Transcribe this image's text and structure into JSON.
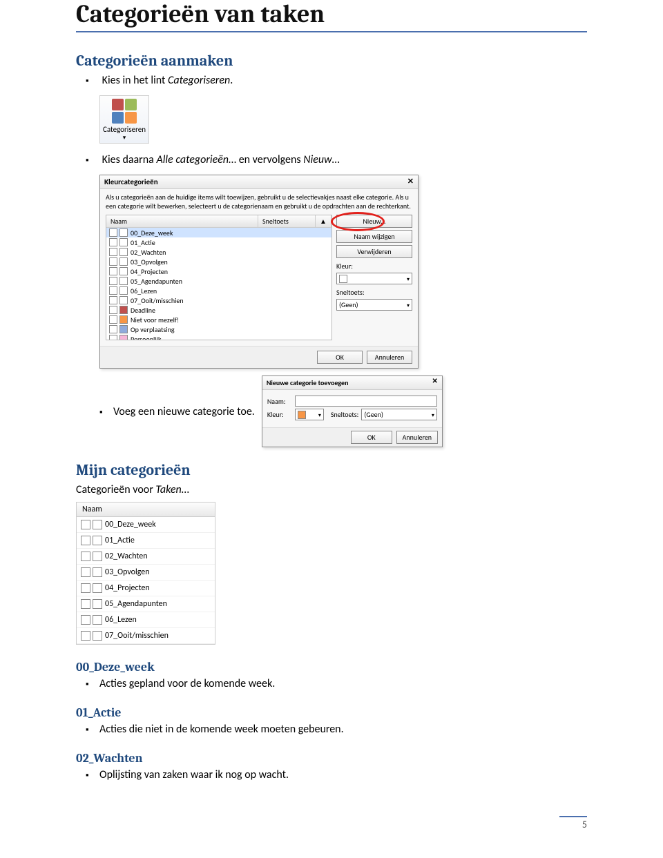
{
  "page": {
    "title": "Categorieën van taken",
    "page_number": "5"
  },
  "sections": {
    "aanmaken": {
      "title": "Categorieën aanmaken",
      "step1_pre": "Kies in het lint ",
      "step1_em": "Categoriseren",
      "step1_post": ".",
      "step2_pre": "Kies daarna ",
      "step2_em": "Alle categorieën",
      "step2_mid": "… en vervolgens ",
      "step2_em2": "Nieuw",
      "step2_post": "…",
      "step3": "Voeg een nieuwe categorie toe."
    },
    "mijn": {
      "title": "Mijn categorieën",
      "intro_pre": "Categorieën voor ",
      "intro_em": "Taken",
      "intro_post": "…"
    },
    "sub_00": {
      "title": "00_Deze_week",
      "bullet": "Acties gepland voor de komende week."
    },
    "sub_01": {
      "title": "01_Actie",
      "bullet": "Acties die niet in de komende week moeten gebeuren."
    },
    "sub_02": {
      "title": "02_Wachten",
      "bullet": "Oplijsting van zaken waar ik nog op wacht."
    }
  },
  "ribbon": {
    "label": "Categoriseren"
  },
  "dlg_main": {
    "title": "Kleurcategorieën",
    "description": "Als u categorieën aan de huidige items wilt toewijzen, gebruikt u de selectievakjes naast elke categorie. Als u een categorie wilt bewerken, selecteert u de categorienaam en gebruikt u de opdrachten aan de rechterkant.",
    "col_name": "Naam",
    "col_sneltoets": "Sneltoets",
    "btn_nieuw": "Nieuw...",
    "btn_rename": "Naam wijzigen",
    "btn_delete": "Verwijderen",
    "lbl_kleur": "Kleur:",
    "lbl_sneltoets": "Sneltoets:",
    "sneltoets_value": "(Geen)",
    "btn_ok": "OK",
    "btn_cancel": "Annuleren",
    "items": [
      {
        "label": "00_Deze_week",
        "swatch": "none",
        "selected": true
      },
      {
        "label": "01_Actie",
        "swatch": "none"
      },
      {
        "label": "02_Wachten",
        "swatch": "none"
      },
      {
        "label": "03_Opvolgen",
        "swatch": "none"
      },
      {
        "label": "04_Projecten",
        "swatch": "none"
      },
      {
        "label": "05_Agendapunten",
        "swatch": "none"
      },
      {
        "label": "06_Lezen",
        "swatch": "none"
      },
      {
        "label": "07_Ooit/misschien",
        "swatch": "none"
      },
      {
        "label": "Deadline",
        "swatch": "red"
      },
      {
        "label": "Niet voor mezelf!",
        "swatch": "orange"
      },
      {
        "label": "Op verplaatsing",
        "swatch": "blue"
      },
      {
        "label": "Persoonlijk",
        "swatch": "pink"
      }
    ]
  },
  "dlg_new": {
    "title": "Nieuwe categorie toevoegen",
    "lbl_naam": "Naam:",
    "lbl_kleur": "Kleur:",
    "lbl_sneltoets": "Sneltoets:",
    "sneltoets_value": "(Geen)",
    "btn_ok": "OK",
    "btn_cancel": "Annuleren"
  },
  "cat_panel": {
    "header": "Naam",
    "items": [
      "00_Deze_week",
      "01_Actie",
      "02_Wachten",
      "03_Opvolgen",
      "04_Projecten",
      "05_Agendapunten",
      "06_Lezen",
      "07_Ooit/misschien"
    ]
  }
}
